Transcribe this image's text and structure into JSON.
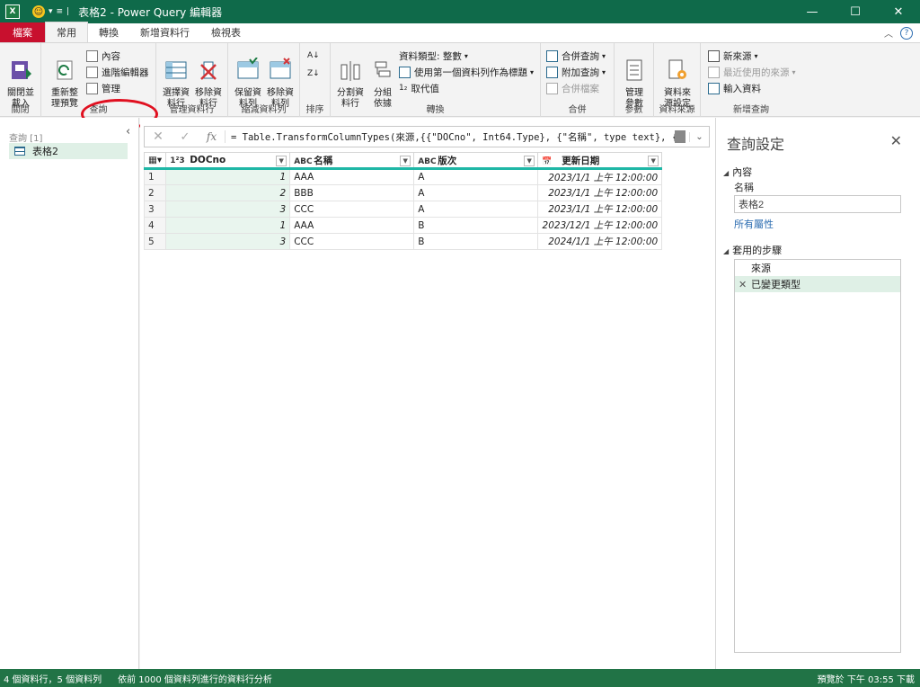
{
  "window": {
    "title": "表格2 - Power Query 編輯器",
    "excel_icon": "X",
    "minimize": "—",
    "maximize": "☐",
    "close": "✕"
  },
  "tabs": [
    {
      "label": "檔案"
    },
    {
      "label": "常用"
    },
    {
      "label": "轉換"
    },
    {
      "label": "新增資料行"
    },
    {
      "label": "檢視表"
    }
  ],
  "ribbon": {
    "close_group": {
      "btn": "關閉並\n載入",
      "label": "關閉"
    },
    "query_group": {
      "refresh": "重新整\n理預覽",
      "properties": "內容",
      "advanced_editor": "進階編輯器",
      "manage": "管理",
      "label": "查詢"
    },
    "manage_cols": {
      "choose": "選擇資\n料行",
      "remove": "移除資\n料行",
      "label": "管理資料行"
    },
    "reduce_rows": {
      "keep": "保留資\n料列",
      "remove": "移除資\n料列",
      "label": "縮減資料列"
    },
    "sort": {
      "label": "排序"
    },
    "transform": {
      "split": "分割資\n料行",
      "group": "分組\n依據",
      "data_type": "資料類型: 整數",
      "first_row": "使用第一個資料列作為標題",
      "replace": "取代值",
      "label": "轉換"
    },
    "combine": {
      "merge": "合併查詢",
      "append": "附加查詢",
      "combine_files": "合併檔案",
      "label": "合併"
    },
    "params": {
      "manage": "管理\n參數",
      "label": "參數"
    },
    "datasource": {
      "settings": "資料來\n源設定",
      "label": "資料來源"
    },
    "newquery": {
      "new_source": "新來源",
      "recent": "最近使用的來源",
      "enter": "輸入資料",
      "label": "新增查詢"
    }
  },
  "left_pane": {
    "header": "查詢 [1]",
    "query": "表格2"
  },
  "formula": {
    "text": "= Table.TransformColumnTypes(來源,{{\"DOCno\", Int64.Type}, {\"名稱\", type text}, {\"版次\","
  },
  "grid": {
    "columns": [
      {
        "type": "1²3",
        "name": "DOCno"
      },
      {
        "type": "ABC",
        "name": "名稱"
      },
      {
        "type": "ABC",
        "name": "版次"
      },
      {
        "type": "📅",
        "name": "更新日期"
      }
    ],
    "rows": [
      {
        "n": "1",
        "docno": "1",
        "name": "AAA",
        "ver": "A",
        "date": "2023/1/1 上午 12:00:00"
      },
      {
        "n": "2",
        "docno": "2",
        "name": "BBB",
        "ver": "A",
        "date": "2023/1/1 上午 12:00:00"
      },
      {
        "n": "3",
        "docno": "3",
        "name": "CCC",
        "ver": "A",
        "date": "2023/1/1 上午 12:00:00"
      },
      {
        "n": "4",
        "docno": "1",
        "name": "AAA",
        "ver": "B",
        "date": "2023/12/1 上午 12:00:00"
      },
      {
        "n": "5",
        "docno": "3",
        "name": "CCC",
        "ver": "B",
        "date": "2024/1/1 上午 12:00:00"
      }
    ]
  },
  "right_pane": {
    "title": "查詢設定",
    "props_section": "內容",
    "name_label": "名稱",
    "name_value": "表格2",
    "all_props": "所有屬性",
    "steps_section": "套用的步驟",
    "steps": [
      {
        "label": "來源"
      },
      {
        "label": "已變更類型"
      }
    ]
  },
  "status": {
    "left": "4 個資料行，5 個資料列",
    "mid": "依前 1000 個資料列進行的資料行分析",
    "right": "預覽於 下午 03:55 下載"
  },
  "colors": {
    "titlebar": "#0f6a4a",
    "statusbar": "#217346",
    "file_tab": "#c8102e",
    "annotation": "#e01020"
  }
}
